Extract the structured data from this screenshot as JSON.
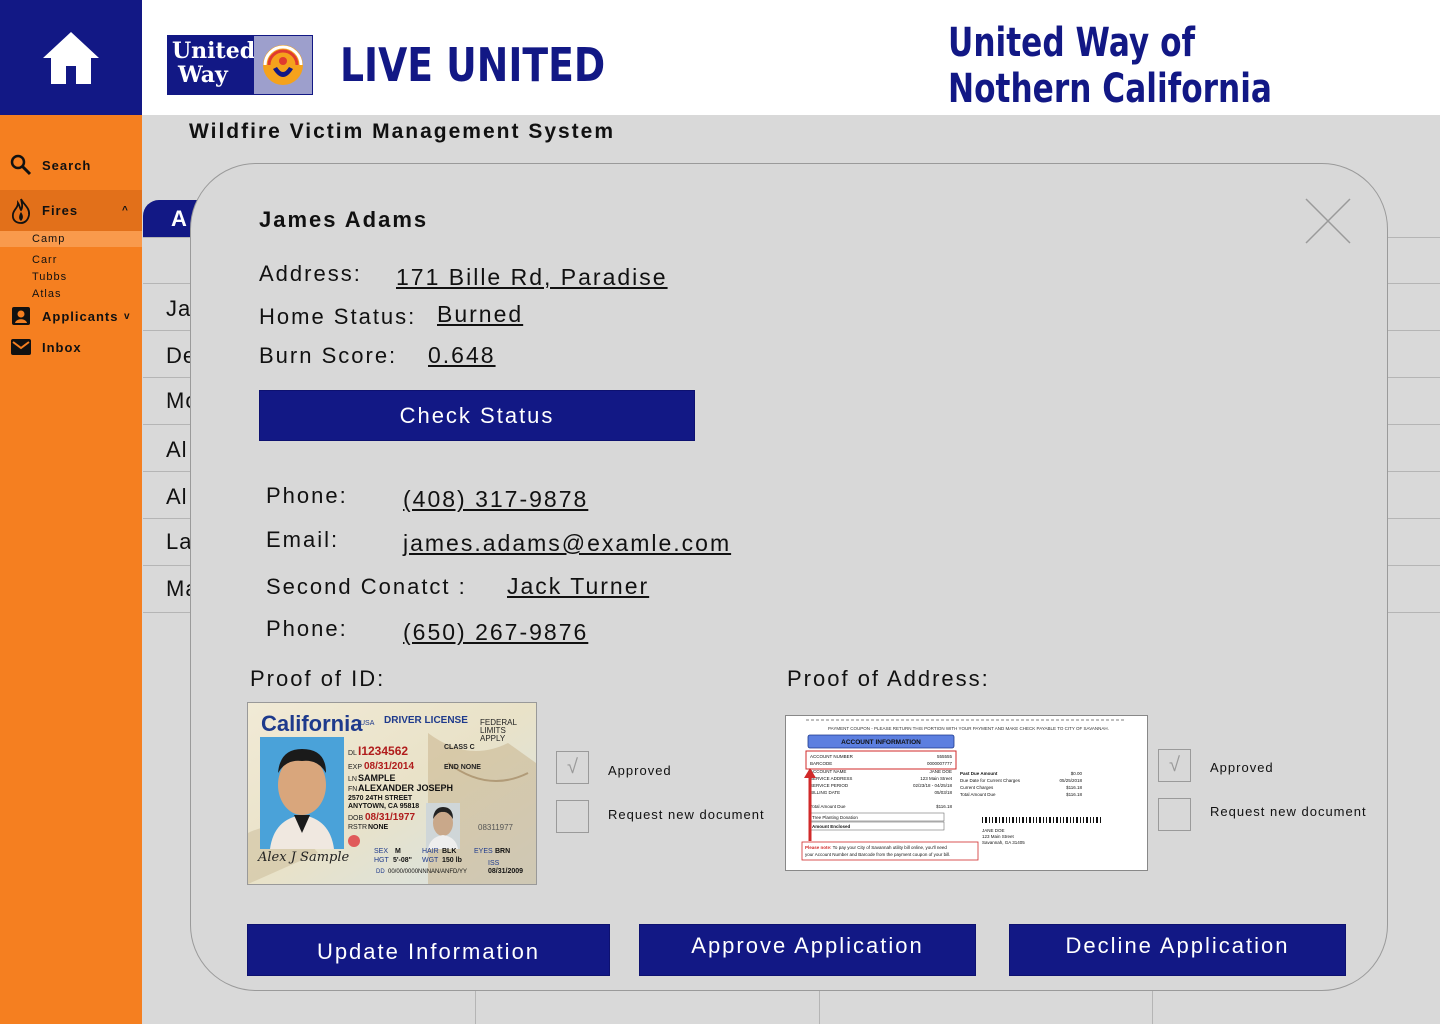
{
  "header": {
    "logo_line1": "United",
    "logo_line2": "Way",
    "tagline": "LIVE UNITED",
    "org_line1": "United Way of",
    "org_line2": "Nothern California"
  },
  "sidebar": {
    "search": "Search",
    "fires": "Fires",
    "fires_expand": "^",
    "fire_items": [
      "Camp",
      "Carr",
      "Tubbs",
      "Atlas"
    ],
    "applicants": "Applicants",
    "applicants_expand": "v",
    "inbox": "Inbox"
  },
  "main": {
    "system_title": "Wildfire Victim Management System",
    "tab_label": "A",
    "row_prefixes": [
      "Ja",
      "De",
      "Mo",
      "Al",
      "Al",
      "La",
      "Ma"
    ]
  },
  "modal": {
    "name": "James Adams",
    "address_label": "Address:",
    "address_value": "171 Bille Rd, Paradise",
    "home_status_label": "Home Status:",
    "home_status_value": "Burned",
    "burn_score_label": "Burn Score:",
    "burn_score_value": "0.648",
    "check_status_button": "Check Status",
    "phone_label": "Phone:",
    "phone_value": "(408) 317-9878",
    "email_label": "Email:",
    "email_value": "james.adams@examle.com",
    "second_contact_label": "Second Conatct :",
    "second_contact_value": "Jack Turner",
    "second_phone_label": "Phone:",
    "second_phone_value": "(650) 267-9876",
    "proof_id_label": "Proof of ID:",
    "proof_address_label": "Proof of Address:",
    "approved_label": "Approved",
    "request_new_label": "Request new document",
    "check_mark": "√",
    "update_button": "Update Information",
    "approve_button": "Approve Application",
    "decline_button": "Decline Application"
  },
  "id_card": {
    "state": "California",
    "usa": "USA",
    "doc_type": "DRIVER LICENSE",
    "federal": "FEDERAL LIMITS APPLY",
    "dl": "I1234562",
    "class": "CLASS C",
    "exp": "08/31/2014",
    "end": "END NONE",
    "last_name": "SAMPLE",
    "first_name": "ALEXANDER JOSEPH",
    "street": "2570 24TH STREET",
    "city": "ANYTOWN, CA 95818",
    "dob": "08/31/1977",
    "rstr": "NONE",
    "sex": "M",
    "hair": "BLK",
    "eyes": "BRN",
    "hgt": "5'-08\"",
    "wgt": "150 lb",
    "iss": "08/31/2009",
    "dd": "00/00/0000NNNAN/ANFD/YY",
    "ghost_date": "08311977",
    "signature": "Alex J Sample"
  },
  "bill": {
    "top_note": "PAYMENT COUPON - PLEASE RETURN THIS PORTION WITH YOUR PAYMENT AND MAKE CHECK PAYABLE TO CITY OF SAVANNAH.",
    "section": "ACCOUNT INFORMATION",
    "account_number_label": "ACCOUNT NUMBER",
    "account_number": "555555",
    "barcode_label": "BARCODE",
    "barcode": "0000007777",
    "account_name_label": "ACCOUNT NAME",
    "account_name": "JANE DOE",
    "service_address_label": "SERVICE ADDRESS",
    "service_address": "123 Main Street",
    "service_period_label": "SERVICE PERIOD",
    "service_period": "02/23/18 - 04/25/18",
    "billing_date_label": "BILLING DATE",
    "billing_date": "05/03/18",
    "total_due_label": "Total Amount Due",
    "total_due": "$116.18",
    "tree_label": "Tree Planting Donation",
    "enclosed_label": "Amount Enclosed",
    "past_due_label": "Past Due Amount",
    "past_due": "$0.00",
    "due_date_label": "Due Date for Current Charges",
    "due_date": "05/25/2018",
    "current_label": "Current Charges",
    "current": "$116.18",
    "total_label": "Total Amount Due",
    "total": "$116.18",
    "addr_name": "JANE DOE",
    "addr_street": "123 Main Street",
    "addr_city": "Savannah, GA 31405",
    "note_bold": "Please note:",
    "note_text": "To pay your City of Savannah utility bill online, you'll need your Account Number and Barcode from the payment coupon of your bill."
  },
  "colors": {
    "navy": "#121885",
    "orange": "#f57f20",
    "orange_dark": "#e2701a",
    "background": "#d9d9d9",
    "modal": "#d8d8d8"
  }
}
